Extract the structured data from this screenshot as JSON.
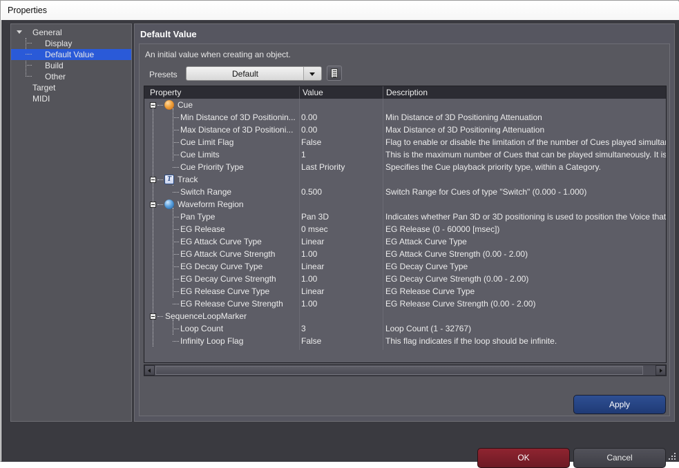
{
  "window": {
    "title": "Properties"
  },
  "tree": {
    "items": [
      {
        "label": "General",
        "depth": 0,
        "expander": "down",
        "selected": false
      },
      {
        "label": "Display",
        "depth": 1,
        "expander": "none",
        "selected": false
      },
      {
        "label": "Default Value",
        "depth": 1,
        "expander": "none",
        "selected": true
      },
      {
        "label": "Build",
        "depth": 1,
        "expander": "none",
        "selected": false
      },
      {
        "label": "Other",
        "depth": 1,
        "expander": "none",
        "selected": false
      },
      {
        "label": "Target",
        "depth": 0,
        "expander": "none",
        "selected": false
      },
      {
        "label": "MIDI",
        "depth": 0,
        "expander": "none",
        "selected": false
      }
    ]
  },
  "panel": {
    "header": "Default Value",
    "subtitle": "An initial value when creating an object."
  },
  "presets": {
    "label": "Presets",
    "value": "Default",
    "options": [
      "Default"
    ],
    "arrow_icon": "chevron-down-icon",
    "menu_icon": "list-menu-icon"
  },
  "grid": {
    "columns": [
      "Property",
      "Value",
      "Description"
    ],
    "rows": [
      {
        "type": "group",
        "icon": "sphere-orange-icon",
        "property": "Cue",
        "value": "",
        "description": ""
      },
      {
        "type": "item",
        "property": "Min Distance of 3D Positionin...",
        "value": "0.00",
        "description": "Min Distance of 3D Positioning Attenuation"
      },
      {
        "type": "item",
        "property": "Max Distance of 3D Positioni...",
        "value": "0.00",
        "description": "Max Distance of 3D Positioning Attenuation"
      },
      {
        "type": "item",
        "property": "Cue Limit Flag",
        "value": "False",
        "description": "Flag to enable or disable the limitation of the number of Cues played simultaneously."
      },
      {
        "type": "item",
        "property": "Cue Limits",
        "value": "1",
        "description": "This is the maximum number of Cues that can be played simultaneously. It is"
      },
      {
        "type": "item",
        "property": "Cue Priority Type",
        "value": "Last Priority",
        "description": "Specifies the Cue playback priority type, within a Category."
      },
      {
        "type": "group",
        "icon": "track-t-icon",
        "property": "Track",
        "value": "",
        "description": ""
      },
      {
        "type": "item",
        "property": "Switch Range",
        "value": "0.500",
        "description": "Switch Range for Cues of type \"Switch\" (0.000 - 1.000)"
      },
      {
        "type": "group",
        "icon": "sphere-blue-icon",
        "property": "Waveform Region",
        "value": "",
        "description": ""
      },
      {
        "type": "item",
        "property": "Pan Type",
        "value": "Pan 3D",
        "description": "Indicates whether Pan 3D or 3D positioning is used to position the Voice that"
      },
      {
        "type": "item",
        "property": "EG Release",
        "value": "0 msec",
        "description": "EG Release (0 - 60000 [msec])"
      },
      {
        "type": "item",
        "property": "EG Attack Curve Type",
        "value": "Linear",
        "description": "EG Attack Curve Type"
      },
      {
        "type": "item",
        "property": "EG Attack Curve Strength",
        "value": "1.00",
        "description": "EG Attack Curve Strength (0.00 - 2.00)"
      },
      {
        "type": "item",
        "property": "EG Decay Curve Type",
        "value": "Linear",
        "description": "EG Decay Curve Type"
      },
      {
        "type": "item",
        "property": "EG Decay Curve Strength",
        "value": "1.00",
        "description": "EG Decay Curve Strength (0.00 - 2.00)"
      },
      {
        "type": "item",
        "property": "EG Release Curve Type",
        "value": "Linear",
        "description": "EG Release Curve Type"
      },
      {
        "type": "item",
        "property": "EG Release Curve Strength",
        "value": "1.00",
        "description": "EG Release Curve Strength (0.00 - 2.00)"
      },
      {
        "type": "group",
        "icon": "none",
        "property": "SequenceLoopMarker",
        "value": "",
        "description": ""
      },
      {
        "type": "item",
        "property": "Loop Count",
        "value": "3",
        "description": "Loop Count (1 - 32767)"
      },
      {
        "type": "item",
        "property": "Infinity Loop Flag",
        "value": "False",
        "description": "This flag indicates if the loop should be infinite."
      }
    ]
  },
  "scrollbar": {
    "left_arrow_icon": "arrow-left-icon",
    "right_arrow_icon": "arrow-right-icon"
  },
  "buttons": {
    "apply": "Apply",
    "ok": "OK",
    "cancel": "Cancel"
  },
  "colors": {
    "accent_blue": "#2a5ad8",
    "apply_blue": "#2e4f93",
    "ok_red": "#8f2430",
    "cancel_gray": "#52525a",
    "panel_bg": "#565660",
    "dialog_bg": "#3a3a40",
    "header_bg": "#2c2c33"
  }
}
